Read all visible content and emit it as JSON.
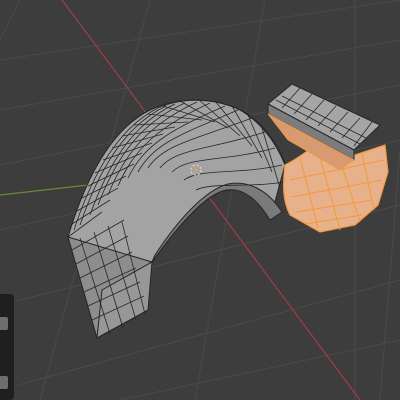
{
  "viewport": {
    "mode": "edit-mode",
    "view": "perspective"
  },
  "colors": {
    "background": "#3d3d3d",
    "grid": "#4a4a4a",
    "x_axis": "#9c3b48",
    "y_axis": "#6a8a3a",
    "face": "#9a9a9a",
    "face_top": "#a7a7a7",
    "face_side": "#8d8d8d",
    "wire": "#262626",
    "selected_face": "#e7b18c",
    "selected_wire": "#f39a3a",
    "sidebar": "#1f1f1f",
    "sidebar_button": "#6e6e6e"
  },
  "icons": {
    "origin": "object-origin-icon",
    "pivot": "3d-cursor-icon"
  },
  "sidebar": {
    "buttons": [
      "toolbar-button",
      "toolbar-button"
    ]
  }
}
